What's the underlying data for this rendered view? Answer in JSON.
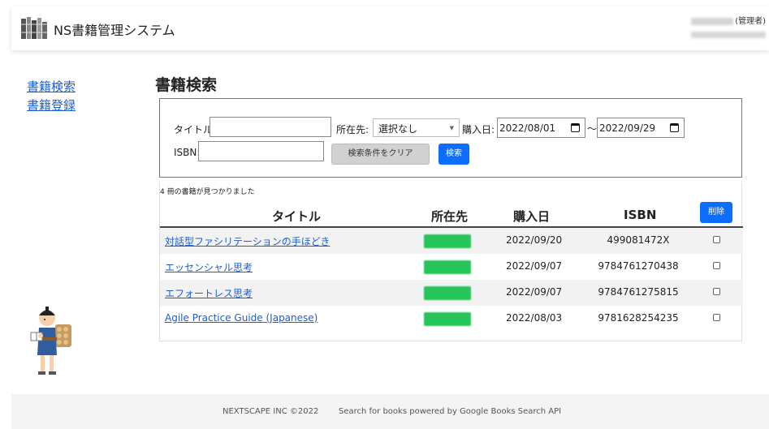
{
  "header": {
    "app_title": "NS書籍管理システム",
    "user_role": "(管理者)",
    "logo_icon": "stacked-books-logo"
  },
  "sidebar": {
    "items": [
      {
        "label": "書籍検索"
      },
      {
        "label": "書籍登録"
      }
    ]
  },
  "main": {
    "page_title": "書籍検索",
    "search": {
      "title_label": "タイトル:",
      "title_value": "",
      "location_label": "所在先:",
      "location_selected": "選択なし",
      "purchase_label": "購入日:",
      "date_from": "2022/08/01",
      "range_sep": "～",
      "date_to": "2022/09/29",
      "isbn_label": "ISBN:",
      "isbn_value": "",
      "clear_label": "検索条件をクリア",
      "search_label": "検索"
    },
    "results": {
      "count_text": "4 冊の書籍が見つかりました",
      "columns": [
        "タイトル",
        "所在先",
        "購入日",
        "ISBN"
      ],
      "delete_label": "削除",
      "rows": [
        {
          "title": "対話型ファシリテーションの手ほどき",
          "date": "2022/09/20",
          "isbn": "499081472X",
          "checked": false
        },
        {
          "title": "エッセンシャル思考",
          "date": "2022/09/07",
          "isbn": "9784761270438",
          "checked": false
        },
        {
          "title": "エフォートレス思考",
          "date": "2022/09/07",
          "isbn": "9784761275815",
          "checked": false
        },
        {
          "title": "Agile Practice Guide (Japanese)",
          "date": "2022/08/03",
          "isbn": "9781628254235",
          "checked": false
        }
      ]
    }
  },
  "footer": {
    "copyright": "NEXTSCAPE INC ©2022",
    "powered": "Search for books powered by Google Books Search API"
  },
  "colors": {
    "link": "#1a5fd0",
    "primary_button": "#0d6efd",
    "location_badge": "#27c45b",
    "clear_button": "#d1d1d1"
  }
}
